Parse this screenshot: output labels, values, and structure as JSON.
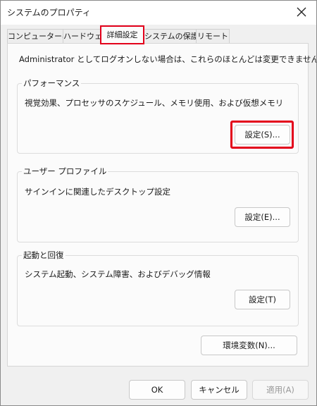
{
  "window": {
    "title": "システムのプロパティ",
    "close_label": "✕"
  },
  "tabs": [
    {
      "label": "コンピューター名",
      "active": false
    },
    {
      "label": "ハードウェア",
      "active": false
    },
    {
      "label": "詳細設定",
      "active": true
    },
    {
      "label": "システムの保護",
      "active": false
    },
    {
      "label": "リモート",
      "active": false
    }
  ],
  "panel": {
    "admin_note": "Administrator としてログオンしない場合は、これらのほとんどは変更できません。",
    "performance": {
      "title": "パフォーマンス",
      "description": "視覚効果、プロセッサのスケジュール、メモリ使用、および仮想メモリ",
      "button": "設定(S)..."
    },
    "user_profile": {
      "title": "ユーザー プロファイル",
      "description": "サインインに関連したデスクトップ設定",
      "button": "設定(E)..."
    },
    "startup_recovery": {
      "title": "起動と回復",
      "description": "システム起動、システム障害、およびデバッグ情報",
      "button": "設定(T)"
    },
    "env_button": "環境変数(N)..."
  },
  "footer": {
    "ok": "OK",
    "cancel": "キャンセル",
    "apply": "適用(A)"
  },
  "colors": {
    "highlight": "#e3001b"
  }
}
